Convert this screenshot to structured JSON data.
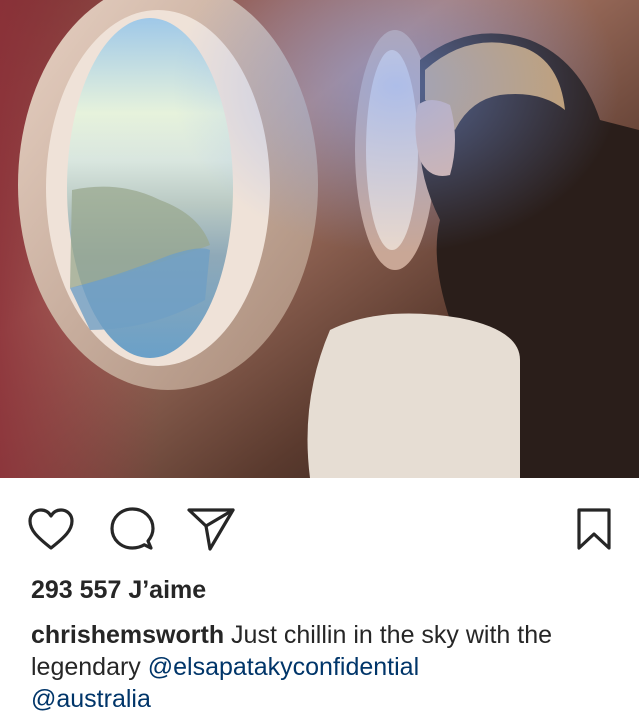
{
  "post": {
    "image": {
      "description_icon": "airplane-window-photo"
    },
    "actions": {
      "like_icon": "heart-outline-icon",
      "comment_icon": "comment-bubble-icon",
      "share_icon": "paper-plane-icon",
      "save_icon": "bookmark-outline-icon"
    },
    "likes_text": "293 557 J’aime",
    "caption": {
      "username": "chrishemsworth",
      "text_before": " Just chillin in the sky with the legendary ",
      "mention_1": "@elsapatakyconfidential",
      "mention_2": "@australia"
    }
  },
  "colors": {
    "text": "#262626",
    "mention": "#003569",
    "background": "#ffffff"
  }
}
